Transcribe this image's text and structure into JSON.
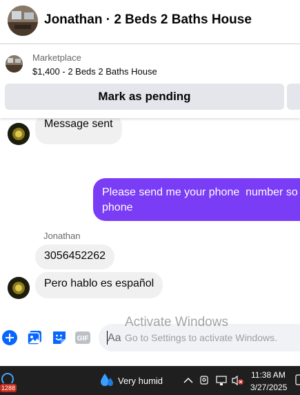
{
  "header": {
    "title": "Jonathan · 2 Beds 2 Baths House"
  },
  "marketplace": {
    "label": "Marketplace",
    "listing": "$1,400 - 2 Beds 2 Baths House",
    "pending_button": "Mark as pending"
  },
  "messages": [
    {
      "direction": "incoming",
      "text": "Message sent"
    },
    {
      "direction": "outgoing",
      "text": "Please send me your phone  number so\nphone"
    },
    {
      "direction": "incoming",
      "sender": "Jonathan",
      "text": "3056452262"
    },
    {
      "direction": "incoming",
      "text": "Pero hablo es español"
    }
  ],
  "composer": {
    "placeholder": "Aa",
    "icons": [
      "add-circle-icon",
      "photo-icon",
      "sticker-icon",
      "gif-icon"
    ],
    "gif_label": "GIF"
  },
  "watermark": {
    "title": "Activate Windows",
    "subtitle": "Go to Settings to activate Windows."
  },
  "taskbar": {
    "badge": "1288",
    "weather": "Very humid",
    "time": "11:38 AM",
    "date": "3/27/2025"
  },
  "colors": {
    "accent": "#0866ff",
    "outgoing_bubble": "#7a3cf5",
    "incoming_bubble": "#f0f0f0",
    "button_bg": "#e4e6eb",
    "taskbar_bg": "#1f1f1f"
  }
}
